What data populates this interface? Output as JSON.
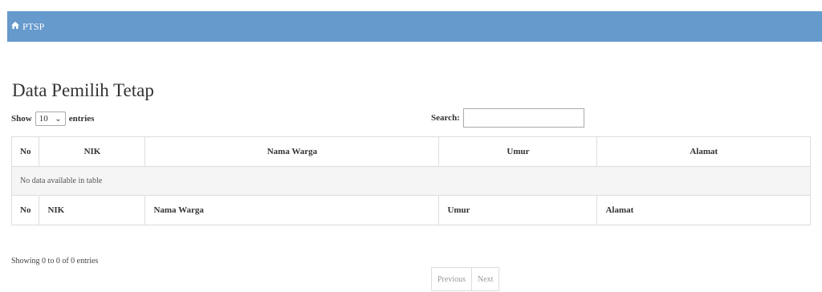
{
  "navbar": {
    "brand": "PTSP",
    "home_icon": "home-icon"
  },
  "page": {
    "title": "Data Pemilih Tetap"
  },
  "length_control": {
    "prefix": "Show",
    "selected": "10",
    "suffix": "entries"
  },
  "search": {
    "label": "Search:",
    "value": ""
  },
  "table": {
    "headers": [
      "No",
      "NIK",
      "Nama Warga",
      "Umur",
      "Alamat"
    ],
    "empty_message": "No data available in table",
    "footers": [
      "No",
      "NIK",
      "Nama Warga",
      "Umur",
      "Alamat"
    ]
  },
  "info": "Showing 0 to 0 of 0 entries",
  "pagination": {
    "previous": "Previous",
    "next": "Next"
  }
}
